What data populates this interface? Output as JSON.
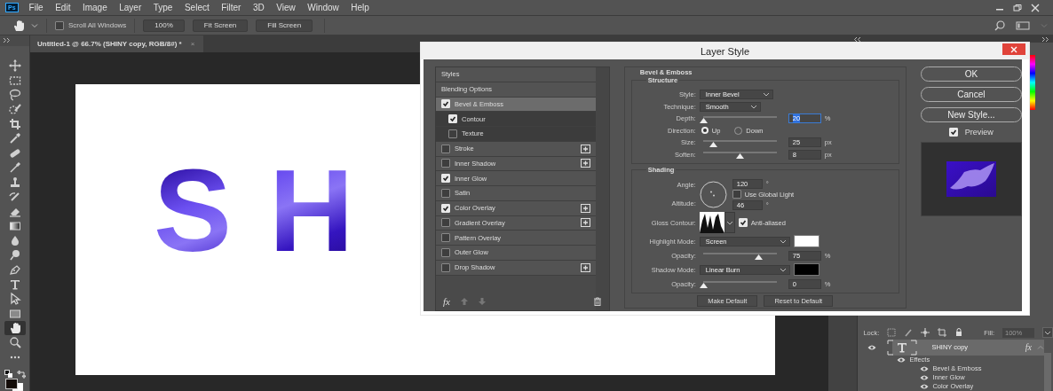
{
  "app": {
    "logo": "Ps",
    "menus": [
      "File",
      "Edit",
      "Image",
      "Layer",
      "Type",
      "Select",
      "Filter",
      "3D",
      "View",
      "Window",
      "Help"
    ]
  },
  "options_bar": {
    "scroll_all": {
      "label": "Scroll All Windows",
      "checked": false
    },
    "buttons": [
      "100%",
      "Fit Screen",
      "Fill Screen"
    ]
  },
  "document_tab": {
    "title": "Untitled-1 @ 66.7% (SHINY copy, RGB/8#) *",
    "close": "×"
  },
  "tools": [
    {
      "kind": "move",
      "selected": false
    },
    {
      "kind": "marquee",
      "selected": false
    },
    {
      "kind": "lasso",
      "selected": false
    },
    {
      "kind": "quick-select",
      "selected": false
    },
    {
      "kind": "crop",
      "selected": false
    },
    {
      "kind": "eyedropper",
      "selected": false
    },
    {
      "kind": "bandage",
      "selected": false
    },
    {
      "kind": "brush",
      "selected": false
    },
    {
      "kind": "stamp",
      "selected": false
    },
    {
      "kind": "history-brush",
      "selected": false
    },
    {
      "kind": "eraser",
      "selected": false
    },
    {
      "kind": "gradient",
      "selected": false
    },
    {
      "kind": "drop",
      "selected": false
    },
    {
      "kind": "dodge",
      "selected": false
    },
    {
      "kind": "pen",
      "selected": false
    },
    {
      "kind": "type",
      "selected": false
    },
    {
      "kind": "path-select",
      "selected": false
    },
    {
      "kind": "rectangle",
      "selected": false
    },
    {
      "kind": "hand",
      "selected": true
    },
    {
      "kind": "zoom",
      "selected": false
    },
    {
      "kind": "more",
      "selected": false
    }
  ],
  "canvas": {
    "text": "SH"
  },
  "dialog": {
    "title": "Layer Style",
    "sections": [
      {
        "label": "Styles",
        "selected": false
      },
      {
        "label": "Blending Options",
        "selected": false
      }
    ],
    "effects": [
      {
        "label": "Bevel & Emboss",
        "kind": "effect",
        "checked": true,
        "selected": true,
        "addable": false
      },
      {
        "label": "Contour",
        "kind": "sub",
        "checked": true,
        "selected": false,
        "addable": false
      },
      {
        "label": "Texture",
        "kind": "sub",
        "checked": false,
        "selected": false,
        "addable": false
      },
      {
        "label": "Stroke",
        "kind": "effect",
        "checked": false,
        "selected": false,
        "addable": true
      },
      {
        "label": "Inner Shadow",
        "kind": "effect",
        "checked": false,
        "selected": false,
        "addable": true
      },
      {
        "label": "Inner Glow",
        "kind": "effect",
        "checked": true,
        "selected": false,
        "addable": false
      },
      {
        "label": "Satin",
        "kind": "effect",
        "checked": false,
        "selected": false,
        "addable": false
      },
      {
        "label": "Color Overlay",
        "kind": "effect",
        "checked": true,
        "selected": false,
        "addable": true
      },
      {
        "label": "Gradient Overlay",
        "kind": "effect",
        "checked": false,
        "selected": false,
        "addable": true
      },
      {
        "label": "Pattern Overlay",
        "kind": "effect",
        "checked": false,
        "selected": false,
        "addable": false
      },
      {
        "label": "Outer Glow",
        "kind": "effect",
        "checked": false,
        "selected": false,
        "addable": false
      },
      {
        "label": "Drop Shadow",
        "kind": "effect",
        "checked": false,
        "selected": false,
        "addable": true
      }
    ],
    "list_footer": {
      "fx": "fx"
    },
    "panel_title": "Bevel & Emboss",
    "structure": {
      "title": "Structure",
      "rows": [
        {
          "kind": "dropdown",
          "label": "Style:",
          "value": "Inner Bevel"
        },
        {
          "kind": "dropdown",
          "label": "Technique:",
          "value": "Smooth"
        },
        {
          "kind": "slider",
          "label": "Depth:",
          "level": 0.0,
          "value": "20",
          "unit": "%",
          "focused": true
        },
        {
          "kind": "radio",
          "label": "Direction:",
          "options": [
            {
              "label": "Up",
              "selected": true
            },
            {
              "label": "Down",
              "selected": false
            }
          ]
        },
        {
          "kind": "slider",
          "label": "Size:",
          "level": 0.14,
          "value": "25",
          "unit": "px",
          "focused": false
        },
        {
          "kind": "slider",
          "label": "Soften:",
          "level": 0.5,
          "value": "8",
          "unit": "px",
          "focused": false
        }
      ]
    },
    "shading": {
      "title": "Shading",
      "rows": [
        {
          "kind": "light",
          "angle": {
            "label": "Angle:",
            "value": "120",
            "unit": "°"
          },
          "global_light": {
            "label": "Use Global Light",
            "checked": false
          },
          "altitude": {
            "label": "Altitude:",
            "value": "46",
            "unit": "°"
          }
        },
        {
          "kind": "contour",
          "label": "Gloss Contour:",
          "anti_aliased": {
            "label": "Anti-aliased",
            "checked": true
          }
        },
        {
          "kind": "dropdown",
          "label": "Highlight Mode:",
          "value": "Screen",
          "color": "#ffffff"
        },
        {
          "kind": "slider",
          "label": "Opacity:",
          "level": 0.75,
          "value": "75",
          "unit": "%",
          "focused": false
        },
        {
          "kind": "dropdown",
          "label": "Shadow Mode:",
          "value": "Linear Burn",
          "color": "#000000"
        },
        {
          "kind": "slider",
          "label": "Opacity:",
          "level": 0.0,
          "value": "0",
          "unit": "%",
          "focused": false
        }
      ]
    },
    "footer_buttons": [
      "Make Default",
      "Reset to Default"
    ],
    "buttons": [
      "OK",
      "Cancel",
      "New Style..."
    ],
    "preview": {
      "label": "Preview",
      "checked": true
    }
  },
  "layers_panel": {
    "lock_label": "Lock:",
    "fill_label": "Fill:",
    "fill_value": "100%",
    "fill_disabled": true,
    "layers": [
      {
        "name": "SHINY copy",
        "selected": true,
        "visible": true,
        "fx": "fx",
        "effects_label": "Effects",
        "effects": [
          {
            "name": "Bevel & Emboss",
            "visible": true
          },
          {
            "name": "Inner Glow",
            "visible": true
          },
          {
            "name": "Color Overlay",
            "visible": true
          }
        ]
      }
    ]
  }
}
